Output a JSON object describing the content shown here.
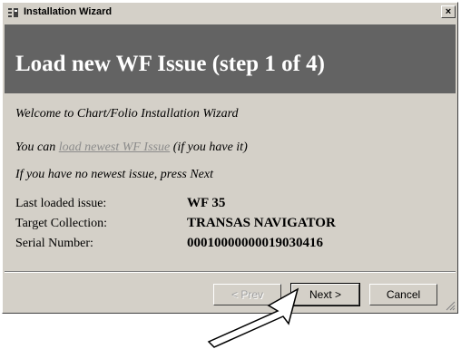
{
  "window": {
    "title": "Installation Wizard",
    "close_label": "×"
  },
  "header": {
    "title": "Load new WF Issue (step 1 of 4)"
  },
  "content": {
    "welcome": "Welcome to Chart/Folio Installation Wizard",
    "load_prefix": "You can ",
    "load_link": "load newest WF Issue",
    "load_suffix": " (if you have it)",
    "next_hint": "If you have no newest issue, press Next"
  },
  "info": [
    {
      "label": "Last loaded issue:",
      "value": "WF 35"
    },
    {
      "label": "Target Collection:",
      "value": "TRANSAS NAVIGATOR"
    },
    {
      "label": "Serial Number:",
      "value": "00010000000019030416"
    }
  ],
  "buttons": {
    "prev": "< Prev",
    "next": "Next >",
    "cancel": "Cancel"
  },
  "colors": {
    "header_bg": "#636363",
    "dialog_bg": "#d4d0c8",
    "link": "#8c8c8c"
  }
}
